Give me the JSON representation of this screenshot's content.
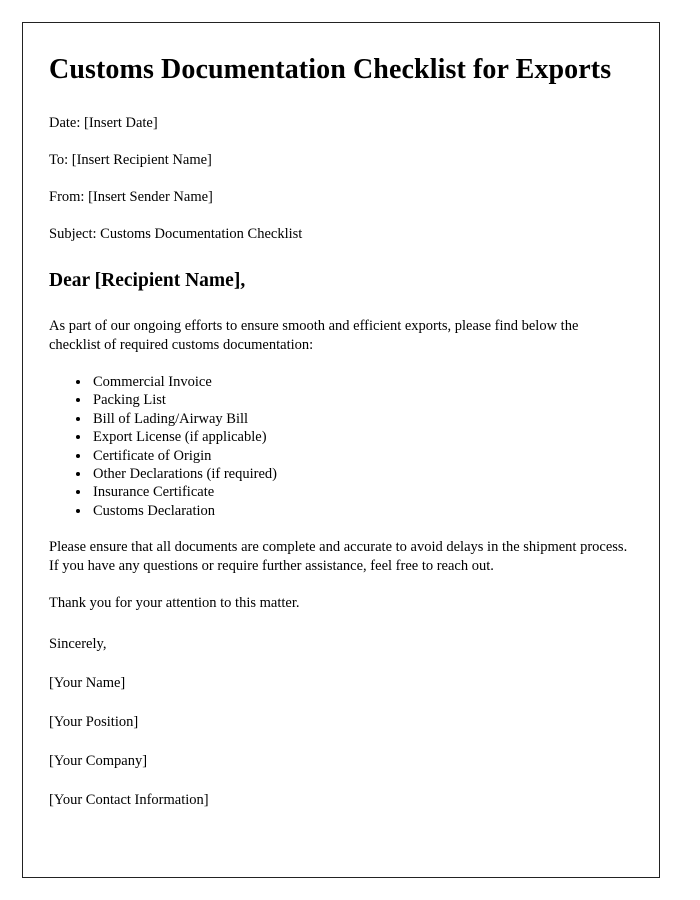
{
  "document": {
    "title": "Customs Documentation Checklist for Exports",
    "meta": {
      "date": "Date: [Insert Date]",
      "to": "To: [Insert Recipient Name]",
      "from": "From: [Insert Sender Name]",
      "subject": "Subject: Customs Documentation Checklist"
    },
    "salutation": "Dear [Recipient Name],",
    "intro_paragraph": "As part of our ongoing efforts to ensure smooth and efficient exports, please find below the checklist of required customs documentation:",
    "checklist": [
      "Commercial Invoice",
      "Packing List",
      "Bill of Lading/Airway Bill",
      "Export License (if applicable)",
      "Certificate of Origin",
      "Other Declarations (if required)",
      "Insurance Certificate",
      "Customs Declaration"
    ],
    "closing_paragraph": "Please ensure that all documents are complete and accurate to avoid delays in the shipment process. If you have any questions or require further assistance, feel free to reach out.",
    "thanks_line": "Thank you for your attention to this matter.",
    "signoff": "Sincerely,",
    "signature": {
      "name": "[Your Name]",
      "position": "[Your Position]",
      "company": "[Your Company]",
      "contact": "[Your Contact Information]"
    }
  },
  "style": {
    "border_color": "#222222",
    "page_background": "#ffffff",
    "text_color": "#000000"
  }
}
